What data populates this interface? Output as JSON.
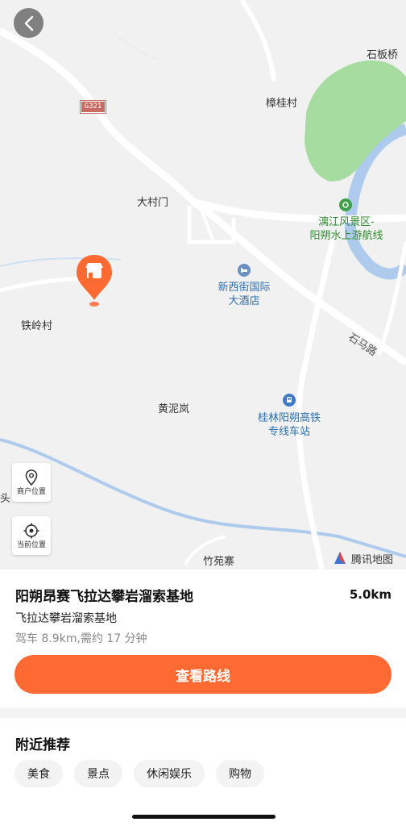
{
  "map": {
    "highway_shield": "G321",
    "labels": {
      "shibanqiao": "石板桥",
      "zhangguicun": "樟桂村",
      "dacunmen": "大村门",
      "lijiang_line1": "漓江风景区-",
      "lijiang_line2": "阳朔水上游航线",
      "hotel_line1": "新西街国际",
      "hotel_line2": "大酒店",
      "tielingcun": "铁岭村",
      "shimalu": "石马路",
      "huangnilan": "黄泥岚",
      "station_line1": "桂林阳朔高铁",
      "station_line2": "专线车站",
      "zhuwanzhai": "竹苑寨",
      "tou": "头"
    },
    "controls": {
      "merchant_location": "商户位置",
      "current_location": "当前位置"
    },
    "attribution": "腾讯地图",
    "colors": {
      "background": "#f1f1f1",
      "road": "#ffffff",
      "water": "#aecbee",
      "park": "#a6dc9f",
      "marker": "#ff6a33"
    }
  },
  "place": {
    "name": "阳朔昂赛飞拉达攀岩溜索基地",
    "distance": "5.0km",
    "subtitle": "飞拉达攀岩溜索基地",
    "drive_info": "驾车 8.9km,需约 17 分钟",
    "route_button": "查看路线"
  },
  "nearby": {
    "title": "附近推荐",
    "chips": [
      "美食",
      "景点",
      "休闲娱乐",
      "购物"
    ]
  },
  "accent": "#ff6a33"
}
